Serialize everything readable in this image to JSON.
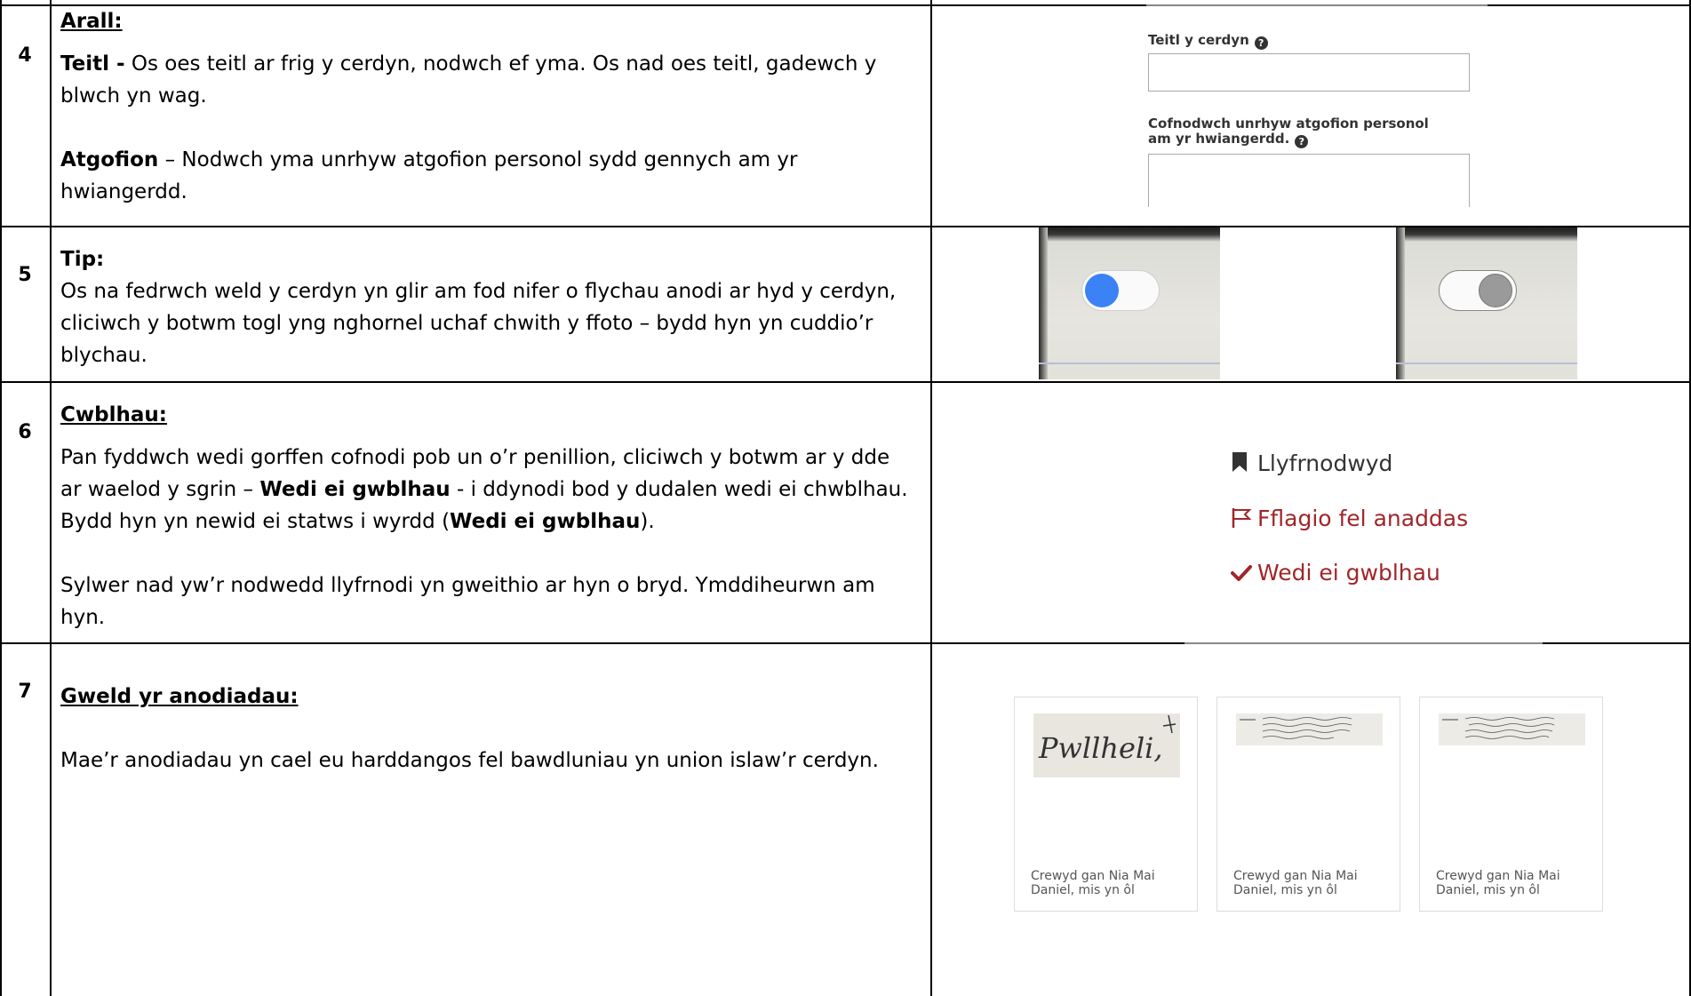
{
  "rows": [
    {
      "number": "4",
      "heading": "Arall:",
      "para1_bold": "Teitl -",
      "para1_text": " Os oes teitl ar frig y cerdyn, nodwch ef yma.  Os nad oes teitl, gadewch y blwch yn wag.",
      "para2_bold": "Atgofion",
      "para2_text": " – Nodwch yma unrhyw atgofion personol sydd gennych am yr hwiangerdd.",
      "form": {
        "title_label": "Teitl y cerdyn",
        "memories_label": "Cofnodwch unrhyw atgofion personol am yr hwiangerdd.",
        "help_icon": "question-circle-icon"
      }
    },
    {
      "number": "5",
      "heading": "Tip:",
      "text": "Os na fedrwch weld y cerdyn yn glir am fod nifer o flychau anodi ar hyd y cerdyn, cliciwch y botwm togl yng nghornel uchaf chwith y ffoto – bydd hyn yn cuddio’r blychau.",
      "toggle_on_color": "#3b82f6",
      "toggle_off_color": "#9a9a9a"
    },
    {
      "number": "6",
      "heading": "Cwblhau:",
      "para1_a": "Pan fyddwch wedi gorffen cofnodi pob un o’r penillion, cliciwch y botwm ar y dde ar waelod y sgrin – ",
      "para1_b": "Wedi ei gwblhau",
      "para1_c": " - i ddynodi bod y dudalen wedi ei chwblhau.  Bydd hyn yn newid ei statws i wyrdd (",
      "para1_d": "Wedi ei gwblhau",
      "para1_e": ").",
      "para2": "Sylwer nad yw’r nodwedd llyfrnodi yn gweithio ar hyn o bryd.  Ymddiheurwn am hyn.",
      "links": {
        "bookmark": "Llyfrnodwyd",
        "flag": "Fflagio fel anaddas",
        "complete": "Wedi ei gwblhau"
      },
      "colors": {
        "bookmark": "#333333",
        "accent": "#a0262a"
      }
    },
    {
      "number": "7",
      "heading": "Gweld yr anodiadau:",
      "text": "Mae’r anodiadau yn cael eu harddangos fel bawdluniau yn union islaw’r cerdyn.",
      "cards": [
        {
          "caption": "Crewyd gan Nia Mai Daniel, mis yn ôl",
          "thumb_text": "Pwllheli,"
        },
        {
          "caption": "Crewyd gan Nia Mai Daniel, mis yn ôl",
          "thumb_text": ""
        },
        {
          "caption": "Crewyd gan Nia Mai Daniel, mis yn ôl",
          "thumb_text": ""
        }
      ]
    }
  ]
}
